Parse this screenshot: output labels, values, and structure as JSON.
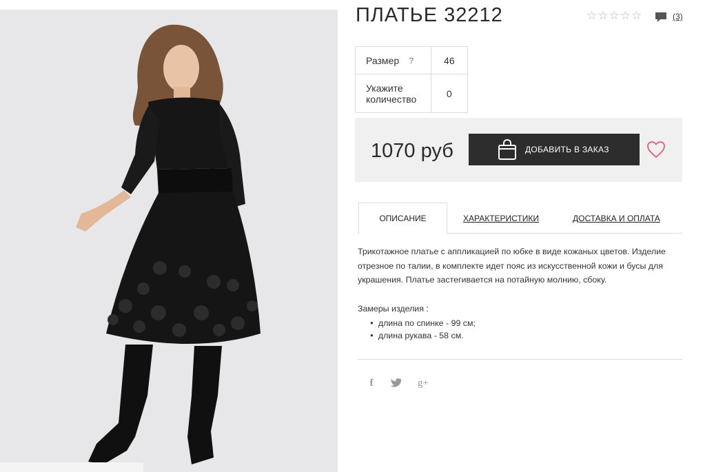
{
  "product": {
    "title": "ПЛАТЬЕ 32212",
    "rating": {
      "stars": [
        "☆",
        "☆",
        "☆",
        "☆",
        "☆"
      ],
      "filled": 0,
      "review_count": "(3)"
    },
    "photo": {
      "colors": {
        "background": "#e7e7e9",
        "dress": "#151515"
      }
    }
  },
  "options": {
    "size_label": "Размер",
    "size_help": "?",
    "size_value": "46",
    "qty_label": "Укажите количество",
    "qty_value": "0"
  },
  "purchase": {
    "price": "1070 руб",
    "add_button_label": "ДОБАВИТЬ В ЗАКАЗ",
    "bag_icon": "shopping-bag-icon",
    "wishlist_icon": "heart-icon",
    "accent_color": "#e06a7a"
  },
  "tabs": [
    {
      "label": "ОПИСАНИЕ",
      "active": true
    },
    {
      "label": "ХАРАКТЕРИСТИКИ",
      "active": false
    },
    {
      "label": "ДОСТАВКА И ОПЛАТА",
      "active": false
    }
  ],
  "description": {
    "text": "Трикотажное платье с аппликацией по юбке в виде кожаных цветов. Изделие отрезное по талии, в комплекте идет пояс из искусственной кожи и бусы для украшения. Платье застегивается на потайную молнию, сбоку.",
    "measures_title": "Замеры изделия :",
    "measures": [
      "длина по спинке - 99 см;",
      "длина рукава - 58 см."
    ]
  },
  "share": {
    "facebook": "f",
    "twitter_icon": "twitter-icon",
    "googleplus": "g+"
  }
}
